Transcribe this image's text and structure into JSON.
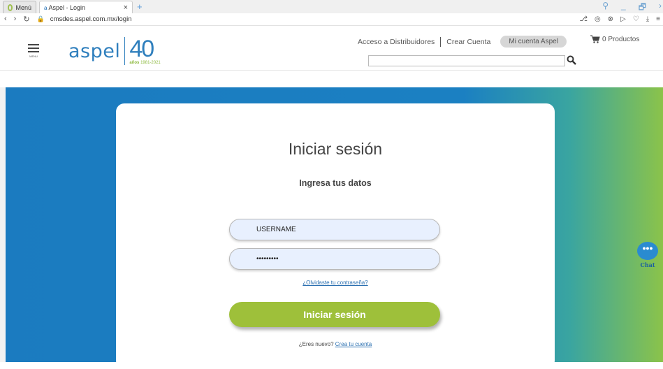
{
  "browser": {
    "menu_tab_label": "Menú",
    "active_tab_favicon": "a",
    "active_tab_label": "Aspel - Login",
    "close_tab": "×",
    "new_tab": "+",
    "url": "cmsdes.aspel.com.mx/login",
    "window_controls": [
      "⚲",
      "_",
      "🗗",
      "›"
    ],
    "addr_icons": [
      "⎇",
      "◎",
      "⊗",
      "▷",
      "♡",
      "⤓",
      "≡"
    ]
  },
  "header": {
    "menu_label": "MENU",
    "logo_text": "aspel",
    "anniversary_number": "40",
    "anniversary_word": "años",
    "anniversary_years": "1981-2021",
    "links": [
      "Acceso a Distribuidores",
      "Crear Cuenta"
    ],
    "account_button": "Mi cuenta Aspel",
    "cart_label": "0 Productos",
    "search_placeholder": ""
  },
  "login": {
    "title": "Iniciar sesión",
    "subtitle": "Ingresa tus datos",
    "username_value": "USERNAME",
    "password_value": "•••••••••",
    "forgot_link": "¿Olvidaste tu contraseña?",
    "submit_label": "Iniciar sesión",
    "new_user_text": "¿Eres nuevo?",
    "create_account_link": "Crea tu cuenta"
  },
  "chat": {
    "bubble": "•••",
    "label": "Chat"
  },
  "colors": {
    "brand_blue": "#2f7fbd",
    "brand_green": "#9ec03a"
  }
}
